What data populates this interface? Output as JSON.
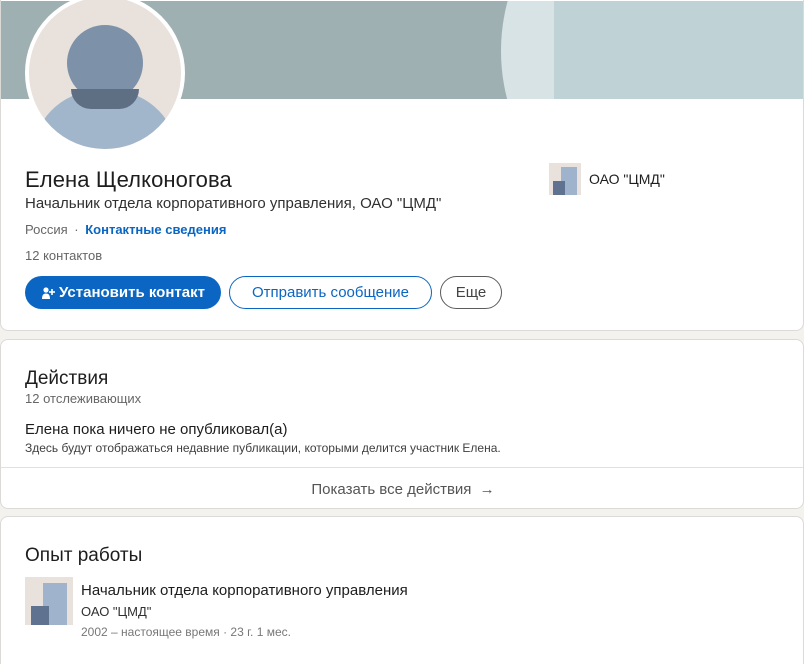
{
  "profile": {
    "name": "Елена Щелконогова",
    "headline": "Начальник отдела корпоративного управления, ОАО \"ЦМД\"",
    "location": "Россия",
    "separator": "·",
    "contact_info_link": "Контактные сведения",
    "connections": "12 контактов",
    "buttons": {
      "connect": "Установить контакт",
      "message": "Отправить сообщение",
      "more": "Еще"
    },
    "current_company": "ОАО \"ЦМД\""
  },
  "activity": {
    "title": "Действия",
    "followers": "12 отслеживающих",
    "empty_title": "Елена пока ничего не опубликовал(а)",
    "empty_desc": "Здесь будут отображаться недавние публикации, которыми делится участник Елена.",
    "show_all": "Показать все действия",
    "arrow": "→"
  },
  "experience": {
    "title": "Опыт работы",
    "items": [
      {
        "position": "Начальник отдела корпоративного управления",
        "company": "ОАО \"ЦМД\"",
        "dates": "2002 – настоящее время · 23 г. 1 мес."
      }
    ]
  },
  "colors": {
    "accent": "#0a66c2",
    "banner": "#a0b2b6",
    "background": "#f4f2ee"
  },
  "icons": [
    "person-add-icon",
    "arrow-right-icon",
    "company-logo",
    "avatar"
  ]
}
